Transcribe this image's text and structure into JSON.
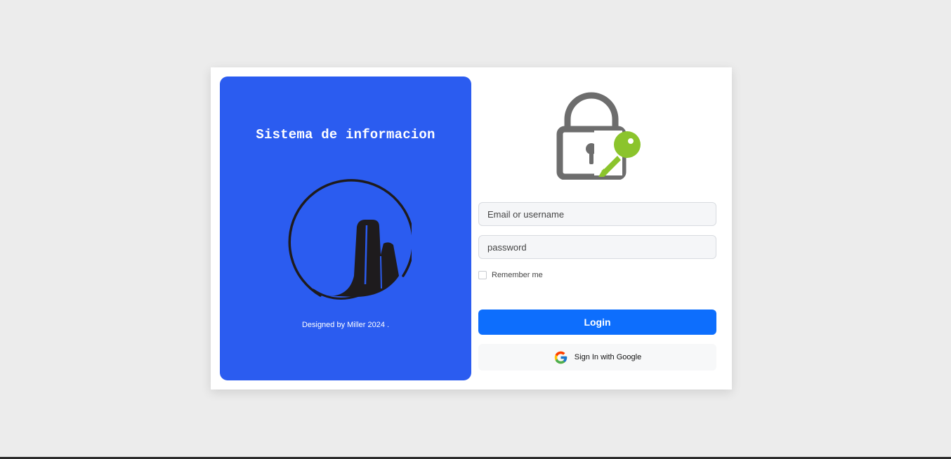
{
  "brand": {
    "title": "Sistema de informacion",
    "credit": "Designed by Miller 2024 .",
    "logo_icon": "circle-building-logo",
    "panel_color": "#2b5cf0"
  },
  "login_form": {
    "lock_icon": "lock-with-key-icon",
    "email_placeholder": "Email or username",
    "password_placeholder": "password",
    "remember_label": "Remember me",
    "remember_checked": false,
    "login_label": "Login",
    "login_color": "#0d6efd",
    "google_icon": "google-icon",
    "google_label": "Sign In with Google"
  }
}
